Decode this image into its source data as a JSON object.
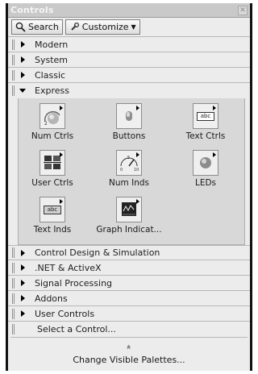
{
  "window": {
    "title": "Controls"
  },
  "toolbar": {
    "search_label": "Search",
    "customize_label": "Customize"
  },
  "categories_top": [
    {
      "label": "Modern"
    },
    {
      "label": "System"
    },
    {
      "label": "Classic"
    }
  ],
  "express": {
    "label": "Express",
    "items": [
      {
        "label": "Num Ctrls"
      },
      {
        "label": "Buttons"
      },
      {
        "label": "Text Ctrls"
      },
      {
        "label": "User Ctrls"
      },
      {
        "label": "Num Inds"
      },
      {
        "label": "LEDs"
      },
      {
        "label": "Text Inds"
      },
      {
        "label": "Graph Indicat..."
      }
    ],
    "icon_text": {
      "abc": "abc"
    }
  },
  "categories_bottom": [
    {
      "label": "Control Design & Simulation"
    },
    {
      "label": ".NET & ActiveX"
    },
    {
      "label": "Signal Processing"
    },
    {
      "label": "Addons"
    },
    {
      "label": "User Controls"
    }
  ],
  "footer": {
    "select_label": "Select a Control...",
    "chevrons": "»",
    "change_label": "Change Visible Palettes..."
  }
}
